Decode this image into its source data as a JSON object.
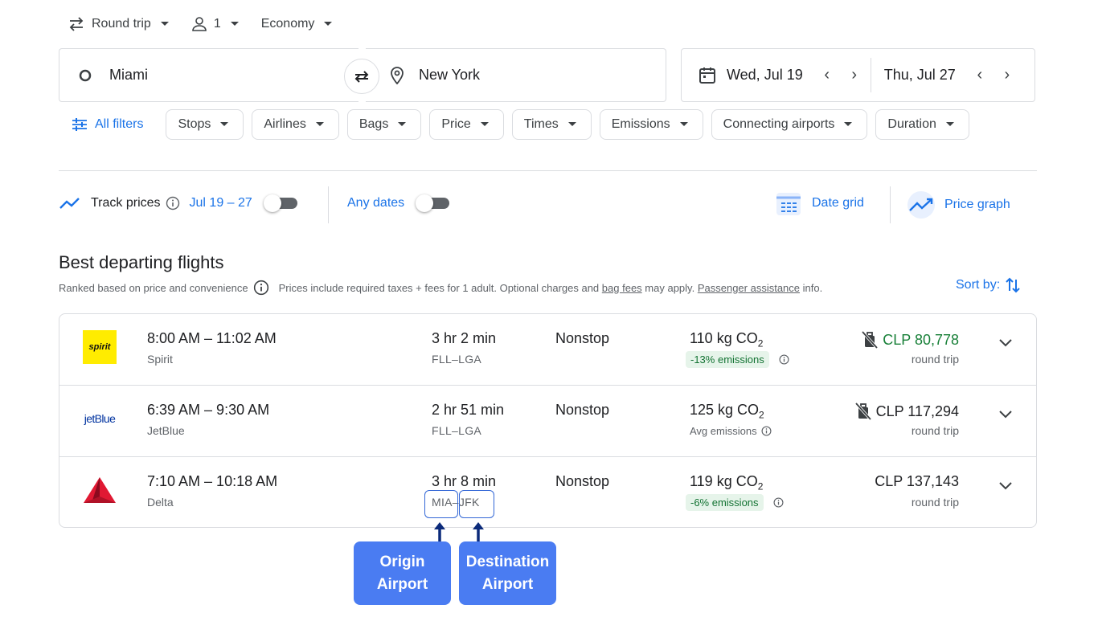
{
  "trip_options": {
    "trip_type": "Round trip",
    "passengers": "1",
    "cabin_class": "Economy"
  },
  "search": {
    "origin": "Miami",
    "destination": "New York",
    "depart_date": "Wed, Jul 19",
    "return_date": "Thu, Jul 27"
  },
  "filters": {
    "all_filters_label": "All filters",
    "chips": [
      "Stops",
      "Airlines",
      "Bags",
      "Price",
      "Times",
      "Emissions",
      "Connecting airports",
      "Duration"
    ]
  },
  "tracking": {
    "track_label": "Track prices",
    "track_range": "Jul 19 – 27",
    "track_enabled": false,
    "any_dates_label": "Any dates",
    "any_dates_enabled": false,
    "date_grid_label": "Date grid",
    "price_graph_label": "Price graph"
  },
  "results": {
    "title": "Best departing flights",
    "ranked_note": "Ranked based on price and convenience",
    "price_note_prefix": "Prices include required taxes + fees for 1 adult. Optional charges and",
    "bag_fees_link": "bag fees",
    "price_note_mid": "may apply.",
    "assistance_link": "Passenger assistance",
    "price_note_suffix": "info.",
    "sort_label": "Sort by:",
    "flights": [
      {
        "logo_text": "spirit",
        "times": "8:00 AM – 11:02 AM",
        "airline": "Spirit",
        "duration": "3 hr 2 min",
        "route": "FLL–LGA",
        "stops": "Nonstop",
        "co2_value": "110 kg CO",
        "co2_sub": "2",
        "emissions": "-13% emissions",
        "price": "CLP 80,778",
        "price_type": "round trip"
      },
      {
        "logo_text": "jetBlue",
        "times": "6:39 AM – 9:30 AM",
        "airline": "JetBlue",
        "duration": "2 hr 51 min",
        "route": "FLL–LGA",
        "stops": "Nonstop",
        "co2_value": "125 kg CO",
        "co2_sub": "2",
        "emissions": "Avg emissions",
        "price": "CLP 117,294",
        "price_type": "round trip"
      },
      {
        "logo_text": "",
        "times": "7:10 AM – 10:18 AM",
        "airline": "Delta",
        "duration": "3 hr 8 min",
        "route": "MIA–JFK",
        "stops": "Nonstop",
        "co2_value": "119 kg CO",
        "co2_sub": "2",
        "emissions": "-6% emissions",
        "price": "CLP 137,143",
        "price_type": "round trip"
      }
    ]
  },
  "annotations": {
    "origin_line1": "Origin",
    "origin_line2": "Airport",
    "destination_line1": "Destination",
    "destination_line2": "Airport"
  },
  "colors": {
    "accent": "#1a73e8",
    "green_price": "#188038",
    "emission_badge_bg": "#e6f4ea",
    "emission_badge_text": "#137333",
    "callout_bg": "#4a7cf2",
    "spirit_yellow": "#ffec00",
    "delta_red": "#e01933"
  }
}
